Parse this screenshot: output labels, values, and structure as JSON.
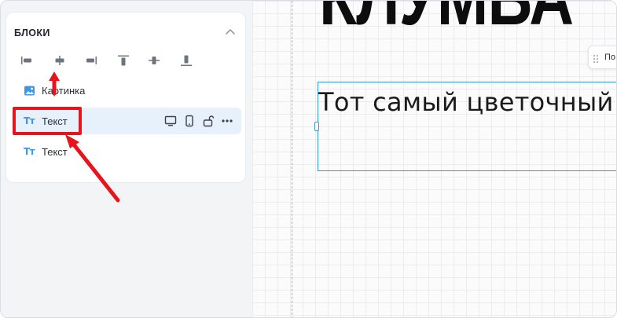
{
  "sidebar": {
    "section_title": "БЛОКИ",
    "collapse_icon": "chevron-up-icon",
    "align_tools": [
      {
        "name": "align-left-icon"
      },
      {
        "name": "align-center-horizontal-icon"
      },
      {
        "name": "align-right-icon"
      },
      {
        "name": "align-top-icon"
      },
      {
        "name": "align-center-vertical-icon"
      },
      {
        "name": "align-bottom-icon"
      }
    ],
    "layers": [
      {
        "label": "Картинка",
        "icon": "image-icon",
        "selected": false
      },
      {
        "label": "Текст",
        "icon": "text-type-icon",
        "icon_text": "Тт",
        "selected": true
      },
      {
        "label": "Текст",
        "icon": "text-type-icon",
        "icon_text": "Тт",
        "selected": false
      }
    ],
    "layer_actions": [
      "desktop-icon",
      "mobile-icon",
      "unlock-icon",
      "more-icon"
    ]
  },
  "canvas": {
    "heading_text": "КЛУМБА",
    "toolbar_stub_label": "По",
    "text_block_content": "Тот самый цветочный"
  },
  "annotation": {
    "color": "#e8141b"
  },
  "colors": {
    "accent": "#3d96e6",
    "selection_bg": "#e7f1fc",
    "selection_border": "#3b97d3"
  }
}
